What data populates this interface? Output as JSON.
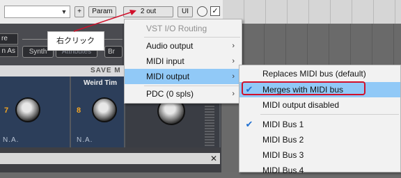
{
  "toolbar": {
    "plus_label": "+",
    "param_label": "Param",
    "io_label": "2 out",
    "ui_label": "UI",
    "bypass_mark": "✓",
    "dropdown_arrow": "▼"
  },
  "plugin": {
    "preset_btn_1": "re",
    "preset_btn_2": "n As",
    "synth_label": "Synth",
    "attributes_label": "Attributes",
    "br_label": "Br",
    "save_label": "SAVE M",
    "panel_title": "Weird Tim",
    "knob_value_1": "7",
    "knob_value_2": "8",
    "na_1": "N.A.",
    "na_2": "N.A.",
    "bottom_close": "✕"
  },
  "callout": {
    "text": "右クリック",
    "border_color": "#d0102a"
  },
  "context_menu": {
    "items": [
      {
        "label": "VST I/O Routing",
        "disabled": true
      },
      {
        "label": "Audio output",
        "arrow": "›"
      },
      {
        "label": "MIDI input",
        "arrow": "›"
      },
      {
        "label": "MIDI output",
        "arrow": "›",
        "highlighted": true
      },
      {
        "label": "PDC (0 spls)",
        "arrow": "›"
      }
    ]
  },
  "submenu": {
    "items": [
      {
        "label": "Replaces MIDI bus (default)",
        "checked": false
      },
      {
        "label": "Merges with MIDI bus",
        "checked": true,
        "highlighted": true
      },
      {
        "label": "MIDI output disabled",
        "checked": false
      },
      {
        "label": "MIDI Bus 1",
        "checked": true
      },
      {
        "label": "MIDI Bus 2",
        "checked": false
      },
      {
        "label": "MIDI Bus 3",
        "checked": false
      },
      {
        "label": "MIDI Bus 4",
        "checked": false
      }
    ],
    "check_glyph": "✔"
  },
  "colors": {
    "menu_highlight": "#91c9f7",
    "annotation_red": "#d0102a",
    "knob_value_orange": "#f5a623"
  }
}
